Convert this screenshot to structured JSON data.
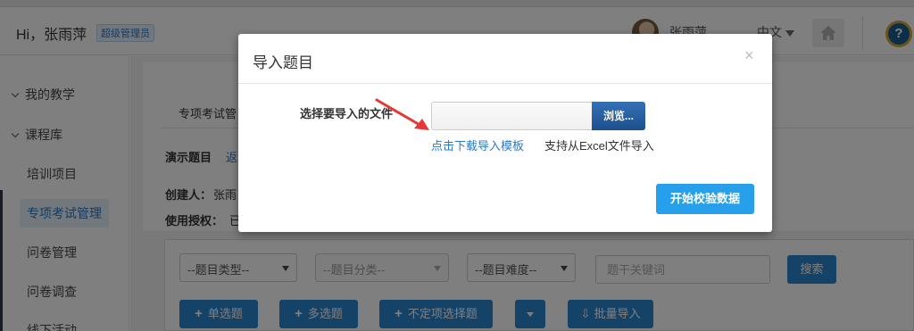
{
  "header": {
    "greeting": "Hi，张雨萍",
    "role_badge": "超级管理员",
    "username": "张雨萍",
    "language": "中文"
  },
  "sidebar": {
    "items": [
      {
        "label": "我的教学",
        "type": "group"
      },
      {
        "label": "课程库",
        "type": "group"
      },
      {
        "label": "培训项目"
      },
      {
        "label": "专项考试管理",
        "active": true
      },
      {
        "label": "问卷管理"
      },
      {
        "label": "问卷调查"
      },
      {
        "label": "线下活动"
      }
    ]
  },
  "main": {
    "tab_label": "专项考试管",
    "demo_title": "演示题目",
    "back_link": "返",
    "creator_label": "创建人：",
    "creator_value": "张雨",
    "auth_label": "使用授权：",
    "auth_value": "已"
  },
  "filters": {
    "type_select": "--题目类型--",
    "category_select": "--题目分类--",
    "difficulty_select": "--题目难度--",
    "keyword_placeholder": "题干关键词",
    "search_label": "搜索"
  },
  "actions": {
    "single_choice": "单选题",
    "multi_choice": "多选题",
    "indefinite_choice": "不定项选择题",
    "batch_import": "批量导入"
  },
  "modal": {
    "title": "导入题目",
    "close": "×",
    "file_label": "选择要导入的文件",
    "browse_label": "浏览...",
    "download_template": "点击下载导入模板",
    "support_text": "支持从Excel文件导入",
    "start_button": "开始校验数据"
  },
  "colors": {
    "primary": "#2b87d1",
    "start_button": "#26a0ea",
    "browse_button": "#1d4f8e",
    "link": "#2b78c5",
    "arrow": "#e53935"
  }
}
